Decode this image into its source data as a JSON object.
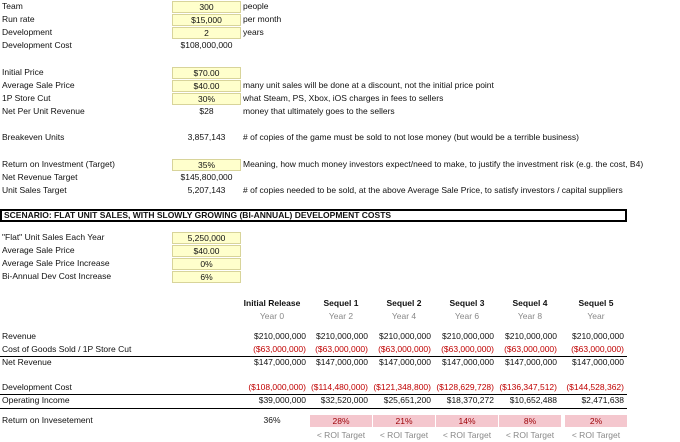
{
  "inputs": [
    {
      "label": "Team",
      "value": "300",
      "note": "people"
    },
    {
      "label": "Run rate",
      "value": "$15,000",
      "note": "per month"
    },
    {
      "label": "Development",
      "value": "2",
      "note": "years"
    },
    {
      "label": "Development Cost",
      "value": "$108,000,000",
      "note": ""
    },
    {
      "label": "Initial Price",
      "value": "$70.00",
      "note": ""
    },
    {
      "label": "Average Sale Price",
      "value": "$40.00",
      "note": "many unit sales will be done at a discount, not the initial price point"
    },
    {
      "label": "1P Store Cut",
      "value": "30%",
      "note": "what Steam, PS, Xbox, iOS charges in fees to sellers"
    },
    {
      "label": "Net Per Unit Revenue",
      "value": "$28",
      "note": "money that ultimately goes to the sellers"
    },
    {
      "label": "Breakeven Units",
      "value": "3,857,143",
      "note": "# of copies of the game must be sold to not lose money (but would be a terrible business)"
    },
    {
      "label": "Return on Investment (Target)",
      "value": "35%",
      "note": "Meaning, how much money investors expect/need to make, to justify the investment risk (e.g. the cost, B4)"
    },
    {
      "label": "Net Revenue Target",
      "value": "$145,800,000",
      "note": ""
    },
    {
      "label": "Unit Sales Target",
      "value": "5,207,143",
      "note": "# of copies needed to be sold, at the above Average Sale Price, to satisfy investors / capital suppliers"
    }
  ],
  "scenario": {
    "title": "SCENARIO: FLAT UNIT SALES, WITH SLOWLY GROWING (BI-ANNUAL) DEVELOPMENT COSTS",
    "params": [
      {
        "label": "\"Flat\" Unit Sales Each Year",
        "value": "5,250,000"
      },
      {
        "label": "Average Sale Price",
        "value": "$40.00"
      },
      {
        "label": "Average Sale Price Increase",
        "value": "0%"
      },
      {
        "label": "Bi-Annual Dev Cost Increase",
        "value": "6%"
      }
    ]
  },
  "table": {
    "columns": [
      {
        "title": "Initial Release",
        "year": "Year 0"
      },
      {
        "title": "Sequel 1",
        "year": "Year 2"
      },
      {
        "title": "Sequel 2",
        "year": "Year 4"
      },
      {
        "title": "Sequel 3",
        "year": "Year 6"
      },
      {
        "title": "Sequel 4",
        "year": "Year 8"
      },
      {
        "title": "Sequel 5",
        "year": "Year"
      }
    ],
    "rows": [
      {
        "label": "Revenue",
        "values": [
          "$210,000,000",
          "$210,000,000",
          "$210,000,000",
          "$210,000,000",
          "$210,000,000",
          "$210,000,000"
        ]
      },
      {
        "label": "Cost of Goods Sold / 1P Store Cut",
        "values": [
          "($63,000,000)",
          "($63,000,000)",
          "($63,000,000)",
          "($63,000,000)",
          "($63,000,000)",
          "($63,000,000)"
        ]
      },
      {
        "label": "Net Revenue",
        "values": [
          "$147,000,000",
          "$147,000,000",
          "$147,000,000",
          "$147,000,000",
          "$147,000,000",
          "$147,000,000"
        ]
      },
      {
        "label": "Development Cost",
        "values": [
          "($108,000,000)",
          "($114,480,000)",
          "($121,348,800)",
          "($128,629,728)",
          "($136,347,512)",
          "($144,528,362)"
        ]
      },
      {
        "label": "Operating Income",
        "values": [
          "$39,000,000",
          "$32,520,000",
          "$25,651,200",
          "$18,370,272",
          "$10,652,488",
          "$2,471,638"
        ]
      }
    ],
    "roi_label": "Return on Invesetement",
    "roi_values": [
      "36%",
      "28%",
      "21%",
      "14%",
      "8%",
      "2%"
    ],
    "roi_target_note": "< ROI Target"
  }
}
